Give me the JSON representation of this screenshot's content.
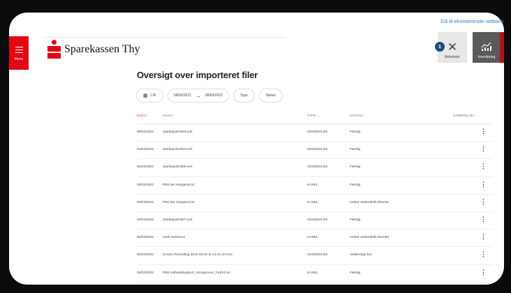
{
  "top_link": "Gå til eksisterende netbank",
  "menu": {
    "label": "Menu"
  },
  "brand": {
    "name": "Sparekassen Thy",
    "color": "#e30613"
  },
  "toolbar": {
    "activities": {
      "label": "Aktiviteter",
      "icon": "close-icon",
      "badge": "1"
    },
    "investing": {
      "label": "Investering",
      "icon": "chart-icon"
    }
  },
  "page_title": "Oversigt over importeret filer",
  "filters": {
    "period": "1 År",
    "from": "08/03/2021",
    "arrow": "→",
    "to": "08/03/2022",
    "type": "Type",
    "status": "Status"
  },
  "table": {
    "headers": {
      "dato": "DATO ↑",
      "navn": "NAVN ↕",
      "type": "TYPE ↕",
      "status": "STATUS ↕",
      "size": "STØRRELSE ↕"
    },
    "rows": [
      {
        "dato": "08/03/2022",
        "navn": "SamlepostAlt23.xml",
        "type": "ISO20022.DK",
        "status": "Færdig"
      },
      {
        "dato": "03/03/2022",
        "navn": "SamlepostAlt10.xml",
        "type": "ISO20022.DK",
        "status": "Færdig"
      },
      {
        "dato": "03/03/2022",
        "navn": "SamlepostAlt09.xml",
        "type": "ISO20022.DK",
        "status": "Færdig"
      },
      {
        "dato": "03/03/2022",
        "navn": "PBS løn mange15.txt",
        "type": "KASEL",
        "status": "Færdig"
      },
      {
        "dato": "03/03/2022",
        "navn": "PBS løn mange14.txt",
        "type": "KASEL",
        "status": "Ordrer underskrift afventer"
      },
      {
        "dato": "03/03/2022",
        "navn": "SamlepostAlt07.xml",
        "type": "ISO20022.DK",
        "status": "Færdig"
      },
      {
        "dato": "02/03/2022",
        "navn": "medi Kaselv.txt",
        "type": "KASEL",
        "status": "Ordrer underskrift afventer"
      },
      {
        "dato": "02/03/2022",
        "navn": "Screen Recording 2022-03-02 at 14.44.42.mov",
        "type": "ISO20022.DK",
        "status": "Validerings fejl"
      },
      {
        "dato": "02/03/2022",
        "navn": "PBS indbetalingskort_1stApprover_FLEX2.txt",
        "type": "KASEL",
        "status": "Færdig"
      }
    ],
    "kebab": "⋮"
  }
}
